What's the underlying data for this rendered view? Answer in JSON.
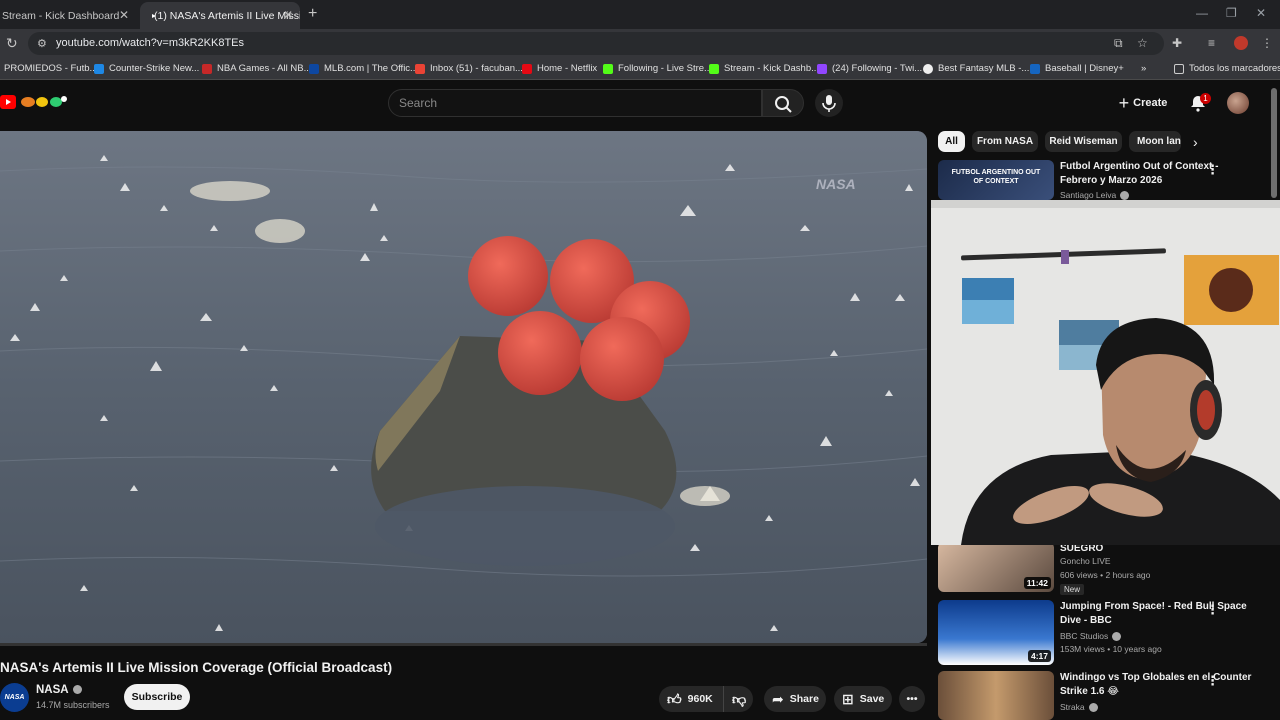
{
  "browser": {
    "tabs": [
      {
        "title": "Stream - Kick Dashboard",
        "active": false
      },
      {
        "title": "(1) NASA's Artemis II Live Missio",
        "active": true
      }
    ],
    "url": "youtube.com/watch?v=m3kR2KK8TEs",
    "bookmarks": [
      {
        "label": "PROMIEDOS - Futb...",
        "color": "#2e7d32"
      },
      {
        "label": "Counter-Strike New...",
        "color": "#1e88e5"
      },
      {
        "label": "NBA Games - All NB...",
        "color": "#c62828"
      },
      {
        "label": "MLB.com | The Offic...",
        "color": "#0d47a1"
      },
      {
        "label": "Inbox (51) - facuban...",
        "color": "#ea4335"
      },
      {
        "label": "Home - Netflix",
        "color": "#e50914"
      },
      {
        "label": "Following - Live Stre...",
        "color": "#53fc18"
      },
      {
        "label": "Stream - Kick Dashb...",
        "color": "#53fc18"
      },
      {
        "label": "(24) Following - Twi...",
        "color": "#9146ff"
      },
      {
        "label": "Best Fantasy MLB -...",
        "color": "#eeeeee"
      },
      {
        "label": "Baseball | Disney+",
        "color": "#1565c0"
      }
    ],
    "all_bookmarks": "Todos los marcadores"
  },
  "header": {
    "search_placeholder": "Search",
    "create_label": "Create",
    "notification_count": "1"
  },
  "video": {
    "title": "NASA's Artemis II Live Mission Coverage (Official Broadcast)",
    "watermark": "NASA",
    "channel": "NASA",
    "channel_logo_text": "NASA",
    "subscribers": "14.7M subscribers",
    "subscribe_label": "Subscribe",
    "likes": "960K",
    "share_label": "Share",
    "save_label": "Save"
  },
  "chips": [
    "All",
    "From NASA",
    "Reid Wiseman",
    "Moon lan"
  ],
  "recommendations": [
    {
      "title": "Futbol Argentino Out of Context - Febrero y Marzo 2026",
      "channel": "Santiago Leiva",
      "thumb_text": "FUTBOL ARGENTINO OUT OF CONTEXT",
      "verified": true
    },
    {
      "title": "SUEGRO",
      "channel": "Goncho LIVE",
      "meta": "606 views • 2 hours ago",
      "badge": "New",
      "duration": "11:42"
    },
    {
      "title": "Jumping From Space! - Red Bull Space Dive - BBC",
      "channel": "BBC Studios",
      "meta": "153M views • 10 years ago",
      "duration": "4:17",
      "verified": true
    },
    {
      "title": "Windingo vs Top Globales en el Counter Strike 1.6 😂",
      "channel": "Straka",
      "verified": true
    }
  ]
}
